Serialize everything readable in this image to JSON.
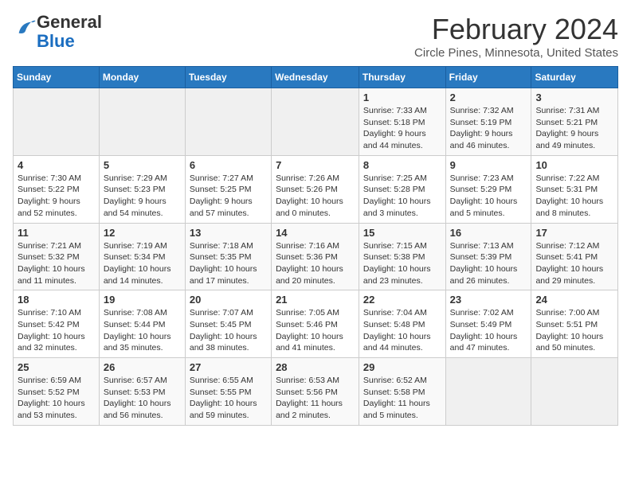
{
  "header": {
    "logo_line1": "General",
    "logo_line2": "Blue",
    "title": "February 2024",
    "subtitle": "Circle Pines, Minnesota, United States"
  },
  "days_of_week": [
    "Sunday",
    "Monday",
    "Tuesday",
    "Wednesday",
    "Thursday",
    "Friday",
    "Saturday"
  ],
  "weeks": [
    [
      {
        "num": "",
        "info": ""
      },
      {
        "num": "",
        "info": ""
      },
      {
        "num": "",
        "info": ""
      },
      {
        "num": "",
        "info": ""
      },
      {
        "num": "1",
        "info": "Sunrise: 7:33 AM\nSunset: 5:18 PM\nDaylight: 9 hours\nand 44 minutes."
      },
      {
        "num": "2",
        "info": "Sunrise: 7:32 AM\nSunset: 5:19 PM\nDaylight: 9 hours\nand 46 minutes."
      },
      {
        "num": "3",
        "info": "Sunrise: 7:31 AM\nSunset: 5:21 PM\nDaylight: 9 hours\nand 49 minutes."
      }
    ],
    [
      {
        "num": "4",
        "info": "Sunrise: 7:30 AM\nSunset: 5:22 PM\nDaylight: 9 hours\nand 52 minutes."
      },
      {
        "num": "5",
        "info": "Sunrise: 7:29 AM\nSunset: 5:23 PM\nDaylight: 9 hours\nand 54 minutes."
      },
      {
        "num": "6",
        "info": "Sunrise: 7:27 AM\nSunset: 5:25 PM\nDaylight: 9 hours\nand 57 minutes."
      },
      {
        "num": "7",
        "info": "Sunrise: 7:26 AM\nSunset: 5:26 PM\nDaylight: 10 hours\nand 0 minutes."
      },
      {
        "num": "8",
        "info": "Sunrise: 7:25 AM\nSunset: 5:28 PM\nDaylight: 10 hours\nand 3 minutes."
      },
      {
        "num": "9",
        "info": "Sunrise: 7:23 AM\nSunset: 5:29 PM\nDaylight: 10 hours\nand 5 minutes."
      },
      {
        "num": "10",
        "info": "Sunrise: 7:22 AM\nSunset: 5:31 PM\nDaylight: 10 hours\nand 8 minutes."
      }
    ],
    [
      {
        "num": "11",
        "info": "Sunrise: 7:21 AM\nSunset: 5:32 PM\nDaylight: 10 hours\nand 11 minutes."
      },
      {
        "num": "12",
        "info": "Sunrise: 7:19 AM\nSunset: 5:34 PM\nDaylight: 10 hours\nand 14 minutes."
      },
      {
        "num": "13",
        "info": "Sunrise: 7:18 AM\nSunset: 5:35 PM\nDaylight: 10 hours\nand 17 minutes."
      },
      {
        "num": "14",
        "info": "Sunrise: 7:16 AM\nSunset: 5:36 PM\nDaylight: 10 hours\nand 20 minutes."
      },
      {
        "num": "15",
        "info": "Sunrise: 7:15 AM\nSunset: 5:38 PM\nDaylight: 10 hours\nand 23 minutes."
      },
      {
        "num": "16",
        "info": "Sunrise: 7:13 AM\nSunset: 5:39 PM\nDaylight: 10 hours\nand 26 minutes."
      },
      {
        "num": "17",
        "info": "Sunrise: 7:12 AM\nSunset: 5:41 PM\nDaylight: 10 hours\nand 29 minutes."
      }
    ],
    [
      {
        "num": "18",
        "info": "Sunrise: 7:10 AM\nSunset: 5:42 PM\nDaylight: 10 hours\nand 32 minutes."
      },
      {
        "num": "19",
        "info": "Sunrise: 7:08 AM\nSunset: 5:44 PM\nDaylight: 10 hours\nand 35 minutes."
      },
      {
        "num": "20",
        "info": "Sunrise: 7:07 AM\nSunset: 5:45 PM\nDaylight: 10 hours\nand 38 minutes."
      },
      {
        "num": "21",
        "info": "Sunrise: 7:05 AM\nSunset: 5:46 PM\nDaylight: 10 hours\nand 41 minutes."
      },
      {
        "num": "22",
        "info": "Sunrise: 7:04 AM\nSunset: 5:48 PM\nDaylight: 10 hours\nand 44 minutes."
      },
      {
        "num": "23",
        "info": "Sunrise: 7:02 AM\nSunset: 5:49 PM\nDaylight: 10 hours\nand 47 minutes."
      },
      {
        "num": "24",
        "info": "Sunrise: 7:00 AM\nSunset: 5:51 PM\nDaylight: 10 hours\nand 50 minutes."
      }
    ],
    [
      {
        "num": "25",
        "info": "Sunrise: 6:59 AM\nSunset: 5:52 PM\nDaylight: 10 hours\nand 53 minutes."
      },
      {
        "num": "26",
        "info": "Sunrise: 6:57 AM\nSunset: 5:53 PM\nDaylight: 10 hours\nand 56 minutes."
      },
      {
        "num": "27",
        "info": "Sunrise: 6:55 AM\nSunset: 5:55 PM\nDaylight: 10 hours\nand 59 minutes."
      },
      {
        "num": "28",
        "info": "Sunrise: 6:53 AM\nSunset: 5:56 PM\nDaylight: 11 hours\nand 2 minutes."
      },
      {
        "num": "29",
        "info": "Sunrise: 6:52 AM\nSunset: 5:58 PM\nDaylight: 11 hours\nand 5 minutes."
      },
      {
        "num": "",
        "info": ""
      },
      {
        "num": "",
        "info": ""
      }
    ]
  ]
}
